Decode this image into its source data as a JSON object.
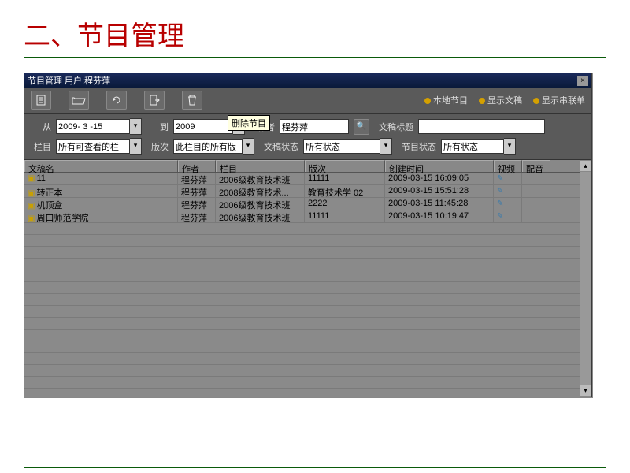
{
  "slide_title": "二、节目管理",
  "window": {
    "title": "节目管理 用户:程芬萍"
  },
  "toolbar": {
    "radio1": "本地节目",
    "radio2": "显示文稿",
    "radio3": "显示串联单"
  },
  "filter": {
    "from_label": "从",
    "from_value": "2009- 3 -15",
    "to_label": "到",
    "to_value": "2009",
    "tooltip": "删除节目",
    "author_label": "作者",
    "author_value": "程芬萍",
    "title_label": "文稿标题",
    "title_value": "",
    "column_label": "栏目",
    "column_value": "所有可查看的栏",
    "edition_label": "版次",
    "edition_value": "此栏目的所有版",
    "docstatus_label": "文稿状态",
    "docstatus_value": "所有状态",
    "progstatus_label": "节目状态",
    "progstatus_value": "所有状态"
  },
  "columns": {
    "c0": "文稿名",
    "c1": "作者",
    "c2": "栏目",
    "c3": "版次",
    "c4": "创建时间",
    "c5": "视频",
    "c6": "配音"
  },
  "rows": [
    {
      "name": "11",
      "author": "程芬萍",
      "col": "2006级教育技术班",
      "ed": "11111",
      "time": "2009-03-15 16:09:05"
    },
    {
      "name": "转正本",
      "author": "程芬萍",
      "col": "2008级教育技术...",
      "ed": "教育技术学 02",
      "time": "2009-03-15 15:51:28"
    },
    {
      "name": "机顶盒",
      "author": "程芬萍",
      "col": "2006级教育技术班",
      "ed": "2222",
      "time": "2009-03-15 11:45:28"
    },
    {
      "name": "周口师范学院",
      "author": "程芬萍",
      "col": "2006级教育技术班",
      "ed": "11111",
      "time": "2009-03-15 10:19:47"
    }
  ]
}
